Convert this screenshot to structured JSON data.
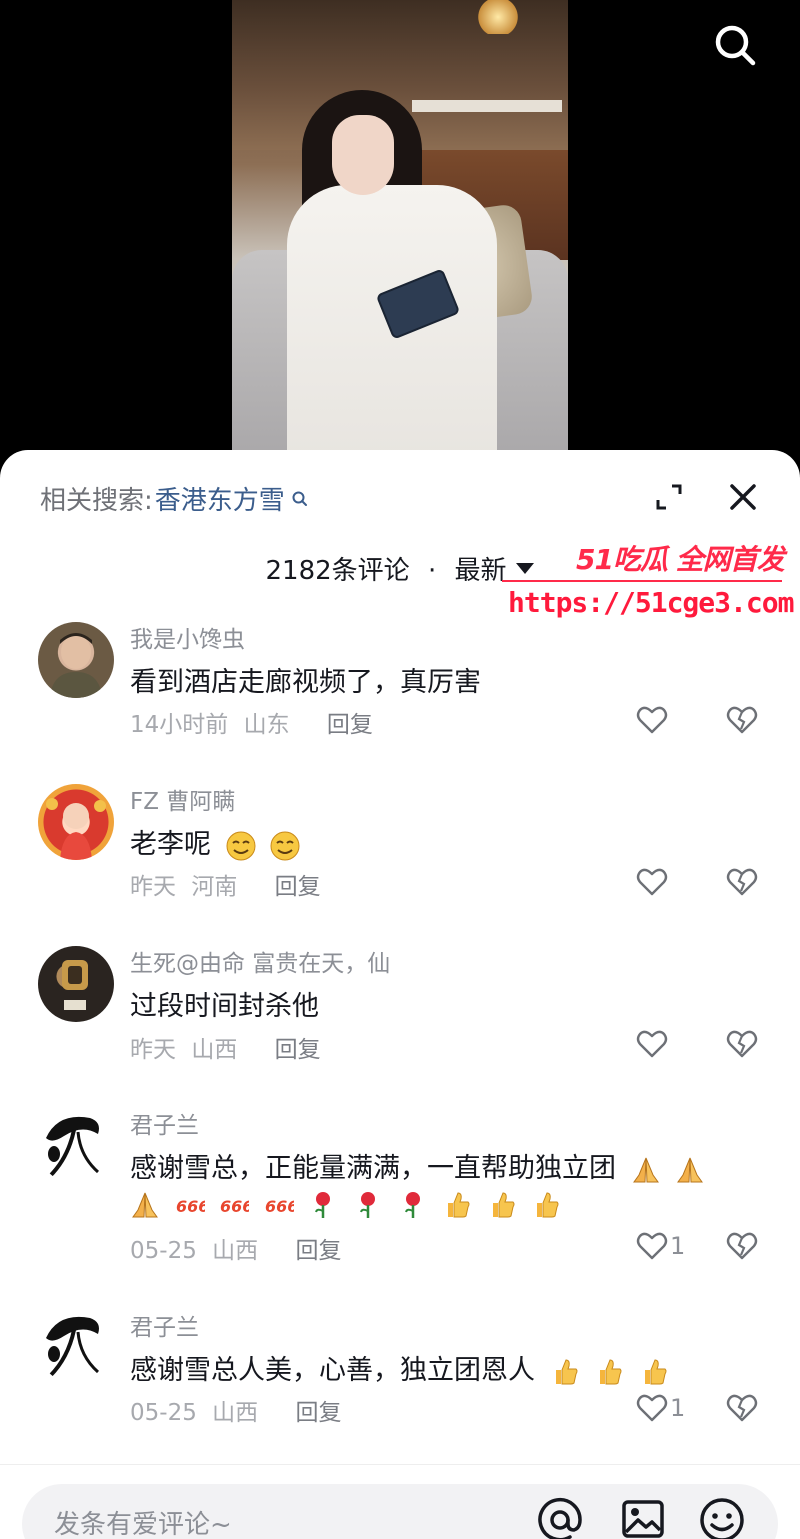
{
  "video": {
    "search_icon": "search-icon"
  },
  "panel": {
    "related_label": "相关搜索:",
    "related_term": "香港东方雪",
    "count_label": "2182条评论",
    "separator": "·",
    "sort_label": "最新",
    "expand_icon": "expand-icon",
    "close_icon": "close-icon"
  },
  "watermark": {
    "title": "51吃瓜 全网首发",
    "url": "https://51cge3.com"
  },
  "comments": [
    {
      "name": "我是小馋虫",
      "text": "看到酒店走廊视频了，真厉害",
      "time": "14小时前",
      "location": "山东",
      "reply": "回复",
      "likes": ""
    },
    {
      "name": "FZ 曹阿瞒",
      "text": "老李呢",
      "time": "昨天",
      "location": "河南",
      "reply": "回复",
      "likes": ""
    },
    {
      "name": "生死@由命 富贵在天，仙",
      "text": "过段时间封杀他",
      "time": "昨天",
      "location": "山西",
      "reply": "回复",
      "likes": ""
    },
    {
      "name": "君子兰",
      "text": "感谢雪总，正能量满满，一直帮助独立团",
      "time": "05-25",
      "location": "山西",
      "reply": "回复",
      "likes": "1"
    },
    {
      "name": "君子兰",
      "text": "感谢雪总人美，心善，独立团恩人",
      "time": "05-25",
      "location": "山西",
      "reply": "回复",
      "likes": "1"
    }
  ],
  "input": {
    "placeholder": "发条有爱评论~"
  },
  "colors": {
    "link": "#3b5d8c",
    "watermark": "#ff2a4a",
    "text": "#16181f",
    "muted": "#8c8f96"
  }
}
